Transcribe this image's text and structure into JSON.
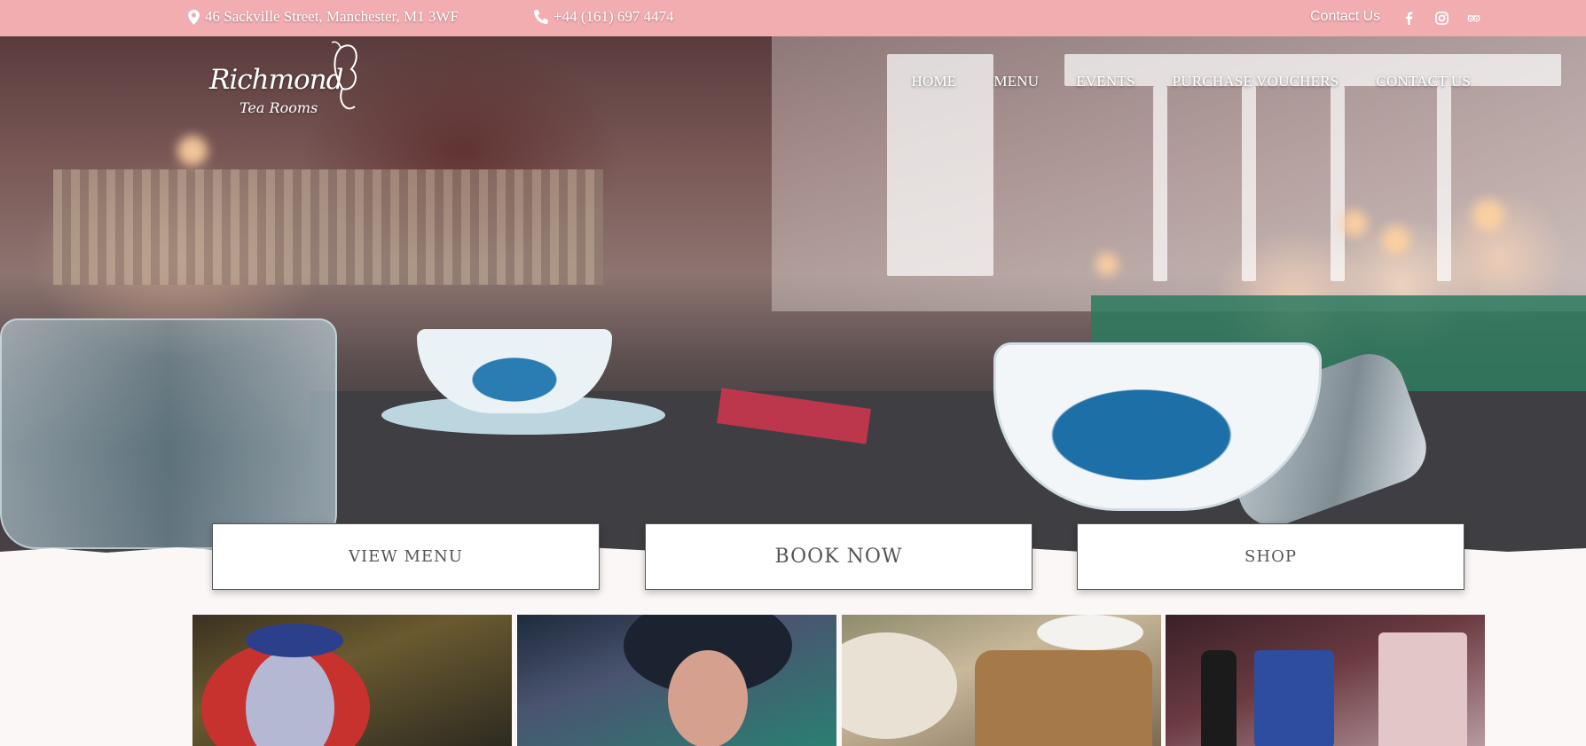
{
  "topbar": {
    "address": "46 Sackville Street, Manchester, M1 3WF",
    "phone": "+44 (161) 697 4474",
    "contact": "Contact Us",
    "social": [
      "facebook-icon",
      "instagram-icon",
      "tripadvisor-icon"
    ]
  },
  "logo": {
    "brand": "Richmond",
    "sub": "Tea Rooms"
  },
  "nav": {
    "home": "HOME",
    "menu": "MENU",
    "events": "EVENTS",
    "vouchers": "PURCHASE VOUCHERS",
    "contact": "CONTACT US"
  },
  "cta": {
    "menu": "VIEW MENU",
    "book": "BOOK NOW",
    "shop": "SHOP"
  },
  "colors": {
    "topbar": "#f2adb1",
    "background": "#fbf7f6",
    "button_text": "#555555"
  }
}
